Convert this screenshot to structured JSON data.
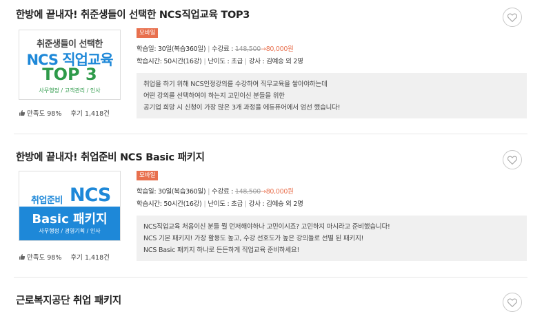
{
  "courses": [
    {
      "title": "한방에 끝내자! 취준생들이 선택한 NCS직업교육 TOP3",
      "badge": "모바일",
      "study_days_label": "학습일",
      "study_days": "30일(복습360일)",
      "fee_label": "수강료",
      "fee_original": "148,500",
      "fee_arrow": "→",
      "fee_sale": "80,000원",
      "time_label": "학습시간",
      "time": "50시간(16강)",
      "level_label": "난이도",
      "level": "초급",
      "teacher_label": "강사",
      "teacher": "김예승 외 2명",
      "desc": [
        "취업을 하기 위해 NCS인정강의를 수강하여 직무교육을 쌓아야하는데",
        "어떤 강의를 선택하여야 하는지 고민이신 분들을 위한",
        "공기업 희망 시 신청이 가장 많은 3개 과정을 에듀퓨어에서 엄선 했습니다!"
      ],
      "satisfaction_label": "만족도",
      "satisfaction": "98%",
      "review_label": "후기",
      "reviews": "1,418건",
      "thumb": {
        "line1": "취준생들이 선택한",
        "line2": "NCS 직업교육",
        "line3": "TOP 3",
        "line4": "사무행정 / 고객관리 / 인사"
      }
    },
    {
      "title": "한방에 끝내자! 취업준비 NCS Basic 패키지",
      "badge": "모바일",
      "study_days_label": "학습일",
      "study_days": "30일(복습360일)",
      "fee_label": "수강료",
      "fee_original": "148,500",
      "fee_arrow": "→",
      "fee_sale": "80,000원",
      "time_label": "학습시간",
      "time": "50시간(16강)",
      "level_label": "난이도",
      "level": "초급",
      "teacher_label": "강사",
      "teacher": "김예승 외 2명",
      "desc": [
        "NCS직업교육 처음이신 분들 뭘 먼저해야하나 고민이시죠? 고민하지 마시라고 준비했습니다!",
        "NCS 기본 패키지! 가장 활용도 높고, 수강 선호도가 높은 강의들로 선별 된 패키지!",
        "NCS Basic 패키지 하나로 든든하게 직업교육 준비하세요!"
      ],
      "satisfaction_label": "만족도",
      "satisfaction": "98%",
      "review_label": "후기",
      "reviews": "1,418건",
      "thumb": {
        "line1": "취업준비",
        "line2": "NCS",
        "line3": "Basic 패키지",
        "line4": "사무행정 / 경영기획 / 인사"
      }
    },
    {
      "title": "근로복지공단 취업 패키지"
    }
  ],
  "colors": {
    "badge": "#e8704e",
    "thumb_blue": "#1e88d8",
    "thumb_green": "#2e9a4a",
    "desc_bg": "#f0f0f0"
  },
  "icons": {
    "favorite": "heart-icon",
    "satisfaction": "thumbs-up-icon"
  }
}
